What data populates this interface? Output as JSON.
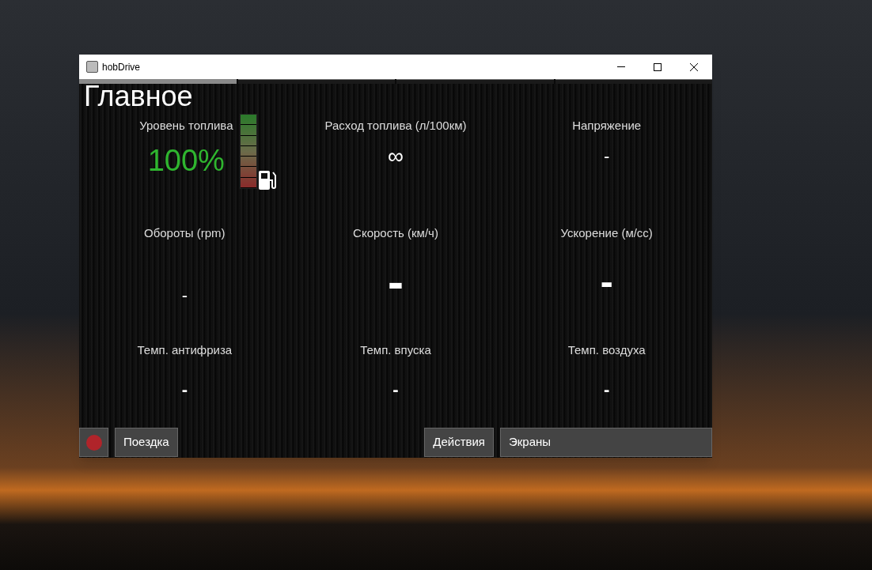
{
  "window": {
    "title": "hobDrive"
  },
  "pages": [
    {
      "selected": true
    },
    {
      "selected": false
    },
    {
      "selected": false
    },
    {
      "selected": false
    }
  ],
  "heading": "Главное",
  "fuel": {
    "label": "Уровень топлива",
    "value": "100%",
    "level": 1
  },
  "gauges": [
    {
      "label": "Расход топлива (л/100км)",
      "value": "∞"
    },
    {
      "label": "Напряжение",
      "value": "-"
    },
    {
      "label": "Обороты (rpm)",
      "value": "-"
    },
    {
      "label": "Скорость (км/ч)",
      "value": "-"
    },
    {
      "label": "Ускорение (м/сс)",
      "value": "-"
    },
    {
      "label": "Темп. антифриза",
      "value": "-"
    },
    {
      "label": "Темп. впуска",
      "value": "-"
    },
    {
      "label": "Темп. воздуха",
      "value": "-"
    }
  ],
  "toolbar": {
    "record_active": true,
    "trip": "Поездка",
    "actions": "Действия",
    "screens": "Экраны"
  }
}
